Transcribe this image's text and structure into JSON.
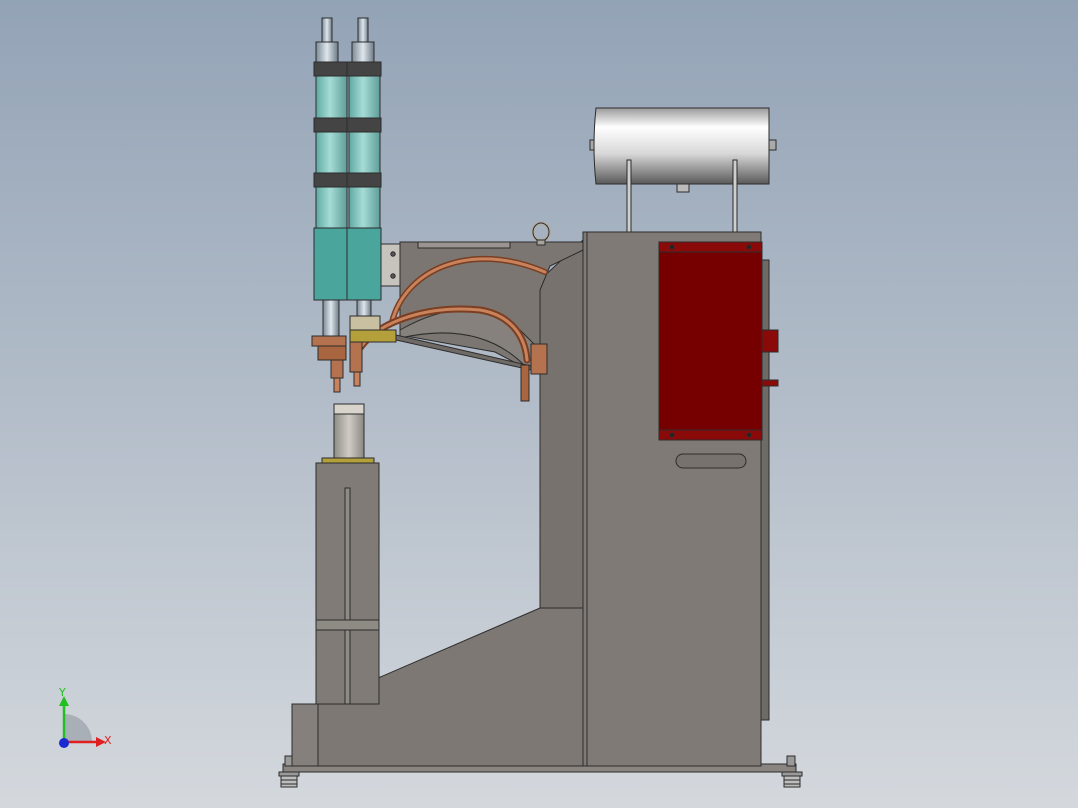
{
  "viewport": {
    "background_top": "#93a3b6",
    "background_bottom": "#d4d8dd"
  },
  "model": {
    "frame_color": "#7d7873",
    "cylinder_color": "#7fc2bd",
    "cylinder_block_color": "#4aa59d",
    "electrical_box_color": "#760000",
    "copper_color": "#b5724f",
    "tank_color": "#e6e6e6"
  },
  "triad": {
    "y_label": "Y",
    "x_label": "X",
    "x_color": "#e02020",
    "y_color": "#20c020",
    "z_color": "#1a2ad0"
  }
}
